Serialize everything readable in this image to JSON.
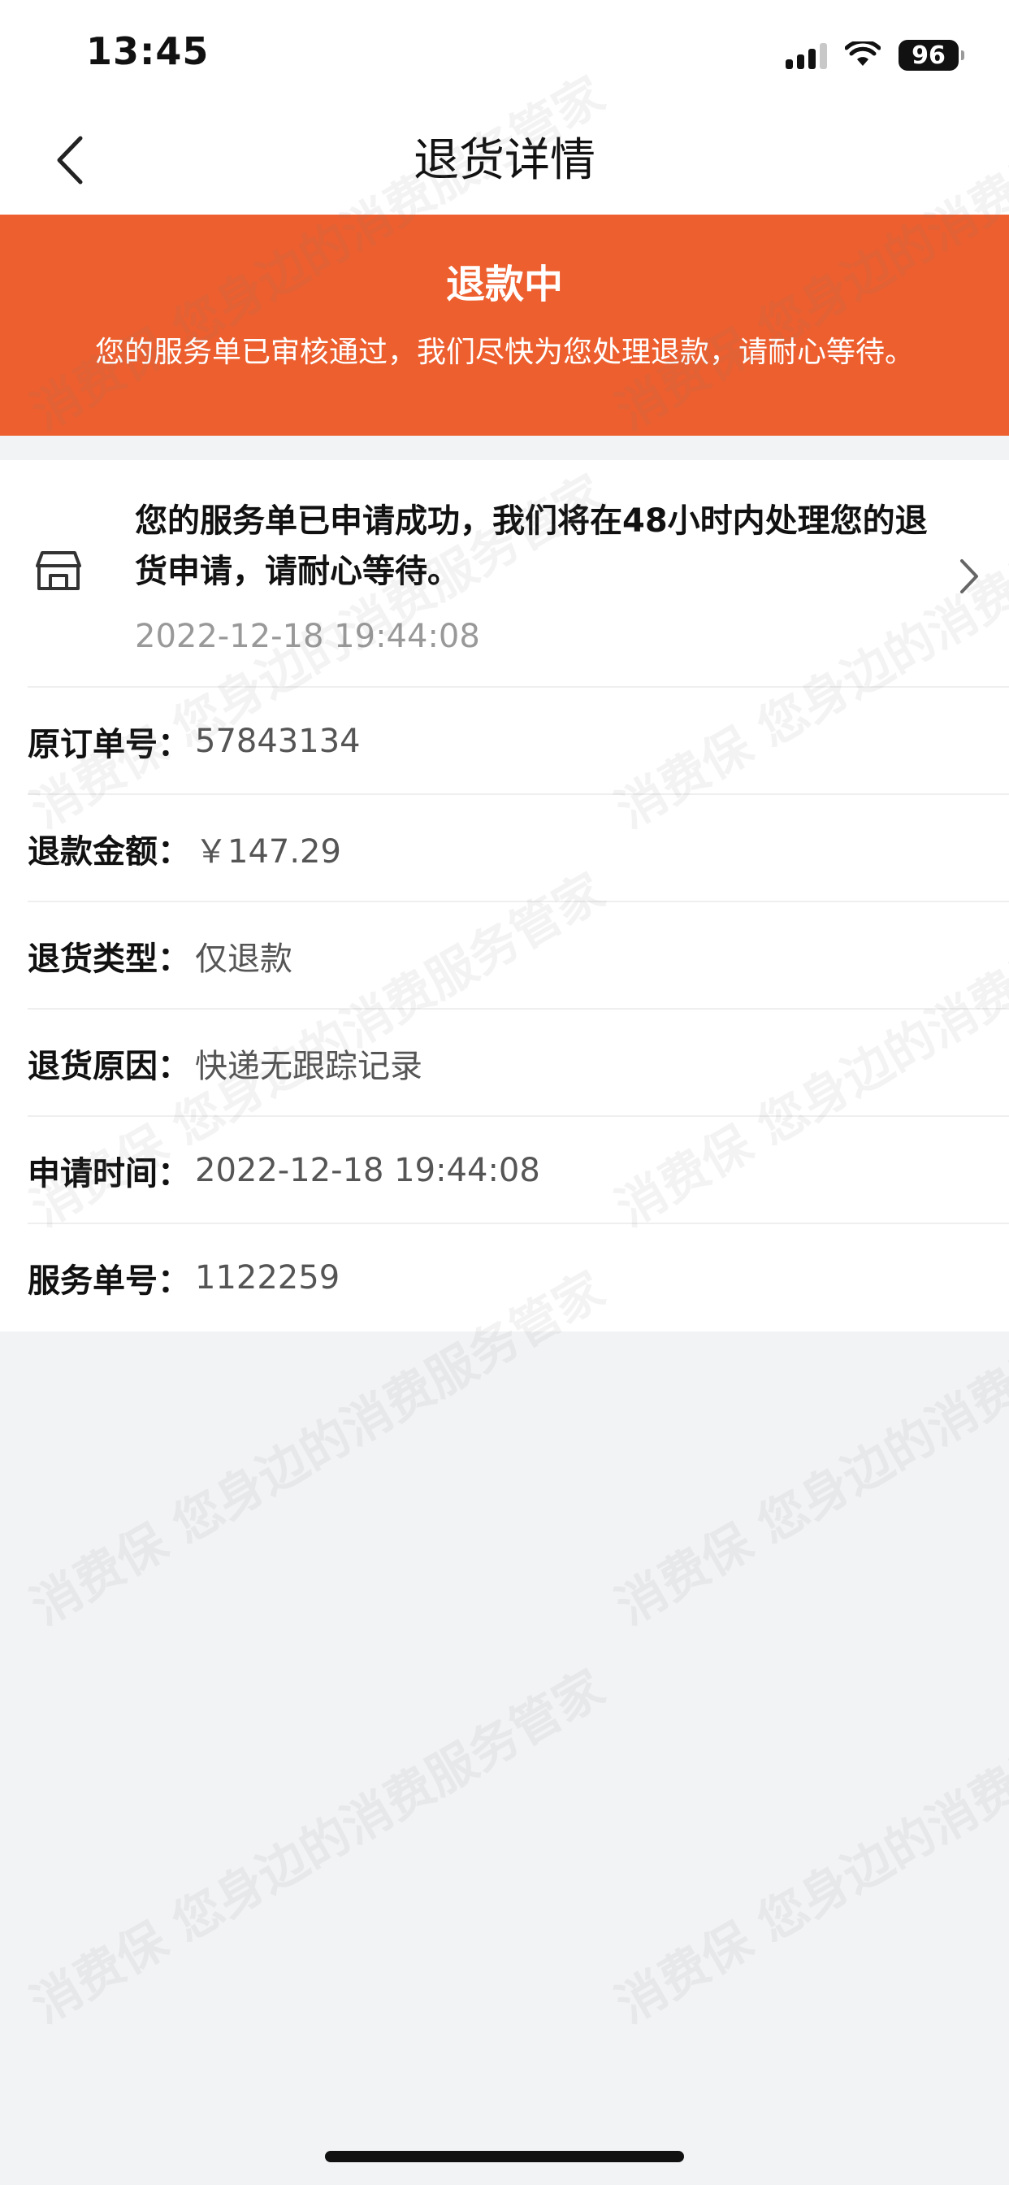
{
  "status_bar": {
    "time": "13:45",
    "battery": "96",
    "icons": [
      "signal-icon",
      "wifi-icon",
      "battery-icon"
    ]
  },
  "nav": {
    "title": "退货详情",
    "back_icon": "chevron-left-icon"
  },
  "banner": {
    "title": "退款中",
    "description": "您的服务单已审核通过，我们尽快为您处理退款，请耐心等待。",
    "color": "#ed5f2f"
  },
  "progress": {
    "icon": "store-icon",
    "message": "您的服务单已申请成功，我们将在48小时内处理您的退货申请，请耐心等待。",
    "time": "2022-12-18 19:44:08",
    "arrow_icon": "chevron-right-icon"
  },
  "details": [
    {
      "label": "原订单号：",
      "value": "57843134"
    },
    {
      "label": "退款金额：",
      "value": "￥147.29"
    },
    {
      "label": "退货类型：",
      "value": "仅退款"
    },
    {
      "label": "退货原因：",
      "value": "快递无跟踪记录"
    },
    {
      "label": "申请时间：",
      "value": "2022-12-18 19:44:08"
    },
    {
      "label": "服务单号：",
      "value": "1122259"
    }
  ],
  "watermark": {
    "text": "消费保 您身边的消费服务管家"
  }
}
